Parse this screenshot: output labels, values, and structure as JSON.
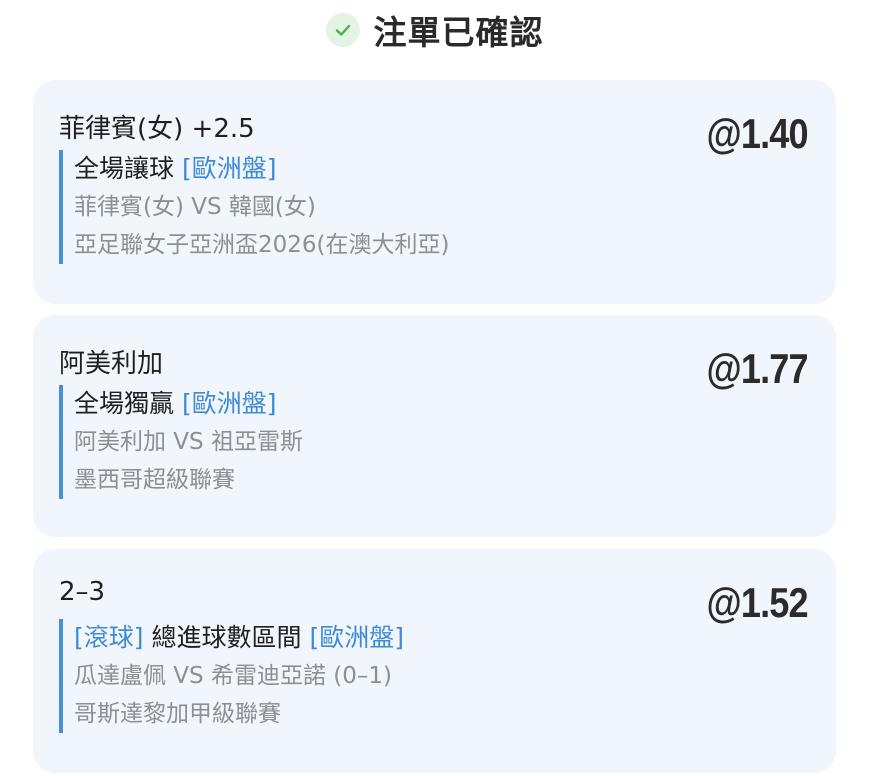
{
  "header": {
    "title": "注單已確認",
    "icon": "check-circle-icon",
    "icon_color": "#4caf50"
  },
  "colors": {
    "card_background": "#f1f6fc",
    "accent_blue": "#3d8ad8",
    "muted_text": "#8c8f94"
  },
  "bets": [
    {
      "selection": "菲律賓(女) +2.5",
      "odds": "@1.40",
      "prefix_tag": "",
      "market": "全場讓球",
      "tag": "[歐洲盤]",
      "match": "菲律賓(女) VS 韓國(女)",
      "league": "亞足聯女子亞洲盃2026(在澳大利亞)"
    },
    {
      "selection": "阿美利加",
      "odds": "@1.77",
      "prefix_tag": "",
      "market": "全場獨贏",
      "tag": "[歐洲盤]",
      "match": "阿美利加 VS 祖亞雷斯",
      "league": "墨西哥超級聯賽"
    },
    {
      "selection": "2–3",
      "odds": "@1.52",
      "prefix_tag": "[滾球]",
      "market": "總進球數區間",
      "tag": "[歐洲盤]",
      "match": "瓜達盧佩 VS 希雷迪亞諾 (0–1)",
      "league": "哥斯達黎加甲級聯賽"
    }
  ]
}
